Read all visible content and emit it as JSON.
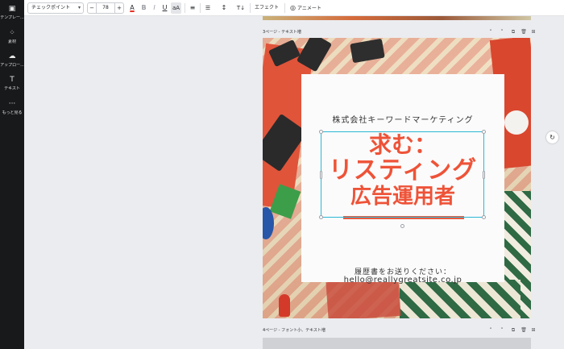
{
  "sidebar": {
    "items": [
      {
        "label": "テンプレー...",
        "icon": "template-icon",
        "glyph": "▣"
      },
      {
        "label": "素材",
        "icon": "elements-icon",
        "glyph": "⁘"
      },
      {
        "label": "アップロー...",
        "icon": "upload-icon",
        "glyph": "☁"
      },
      {
        "label": "テキスト",
        "icon": "text-icon",
        "glyph": "T"
      },
      {
        "label": "もっと見る",
        "icon": "more-icon",
        "glyph": "···"
      }
    ]
  },
  "toolbar": {
    "font_name": "チェックポイント",
    "font_size": "78",
    "minus": "−",
    "plus": "+",
    "text_color_glyph": "A",
    "bold_glyph": "B",
    "italic_glyph": "I",
    "underline_glyph": "U",
    "case_glyph": "aA",
    "align_glyph": "≡",
    "list_glyph": "☰",
    "spacing_glyph": "↕",
    "vertical_glyph": "T↓",
    "effects_label": "エフェクト",
    "animate_label": "アニメート",
    "animate_glyph": "◎",
    "text_color": "#e2352a"
  },
  "pages": {
    "current_label": "3ページ - テキスト増",
    "next_label": "4ページ - フォント小、テキスト増",
    "ctrl_up": "˄",
    "ctrl_down": "˅",
    "ctrl_duplicate": "⧉",
    "ctrl_delete": "🗑",
    "ctrl_add": "⊞"
  },
  "design": {
    "company": "株式会社キーワードマーケティング",
    "headline_1": "求む：",
    "headline_2": "リスティング",
    "headline_3": "広告運用者",
    "apply_text": "履歴書をお送りください：",
    "email": "hello@reallygreatsite.co.jp",
    "accent_color": "#ee5338"
  },
  "side_button_glyph": "↻"
}
